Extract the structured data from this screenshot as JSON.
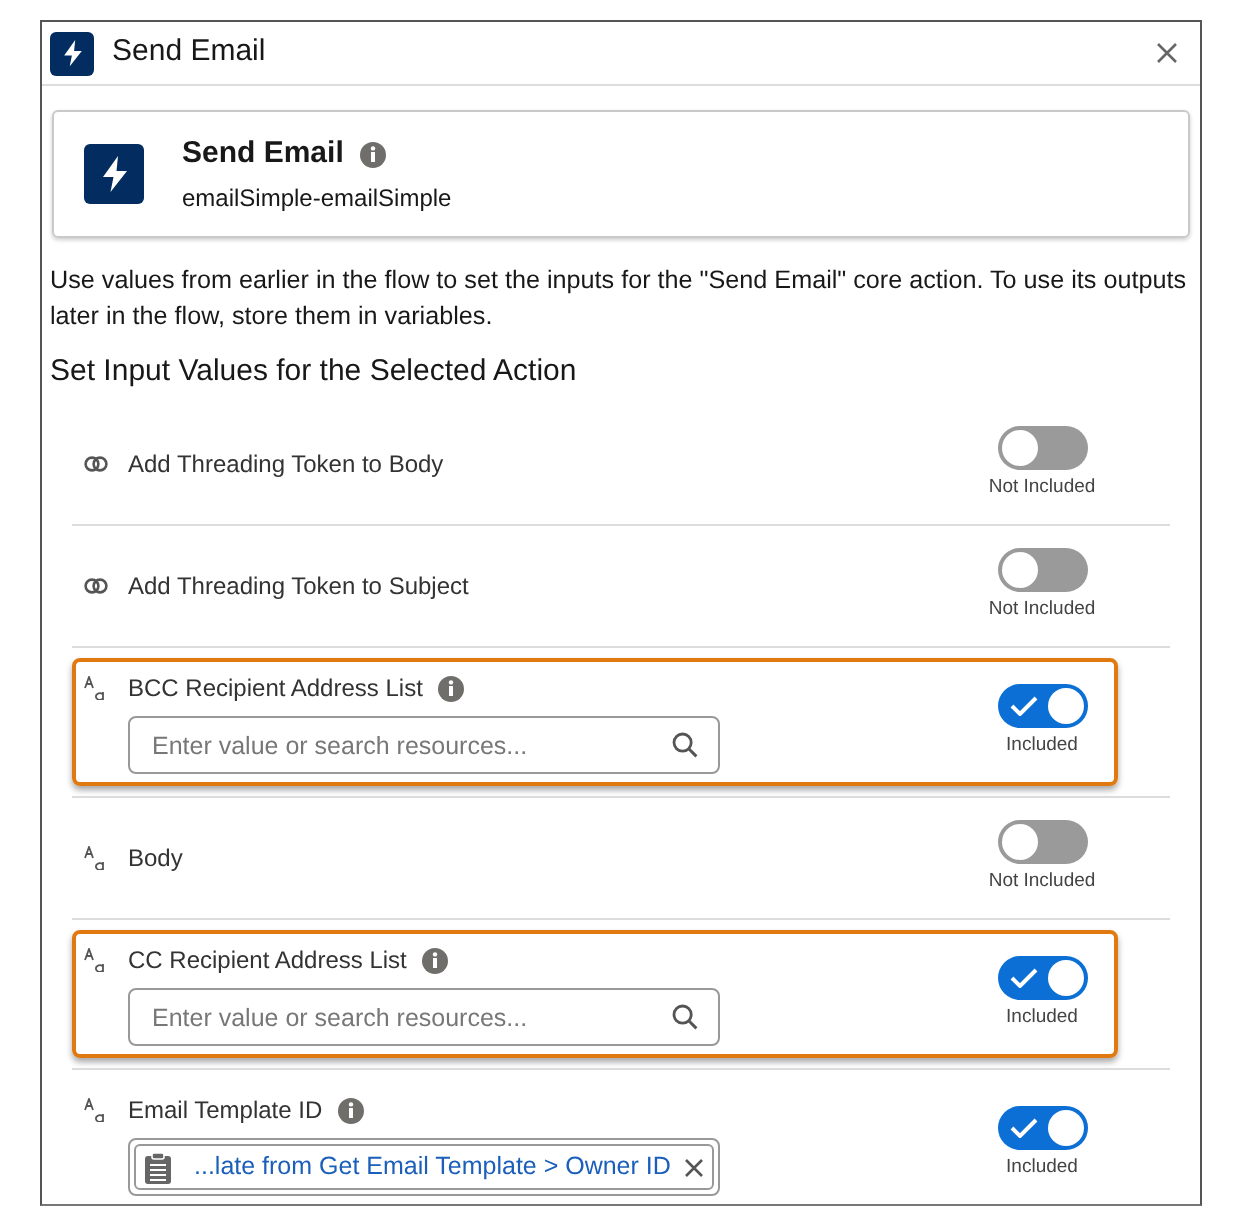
{
  "window": {
    "title": "Send Email"
  },
  "action_card": {
    "title": "Send Email",
    "name": "emailSimple-emailSimple",
    "info": true
  },
  "description": "Use values from earlier in the flow to set the inputs for the \"Send Email\" core action. To use its outputs later in the flow, store them in variables.",
  "section_heading": "Set Input Values for the Selected Action",
  "rows": [
    {
      "kind": "boolean",
      "label": "Add Threading Token to Body",
      "info": false,
      "highlighted": false,
      "included": false,
      "status": "Not Included"
    },
    {
      "kind": "boolean",
      "label": "Add Threading Token to Subject",
      "info": false,
      "highlighted": false,
      "included": false,
      "status": "Not Included"
    },
    {
      "kind": "text",
      "label": "BCC Recipient Address List",
      "info": true,
      "highlighted": true,
      "included": true,
      "status": "Included",
      "field": {
        "placeholder": "Enter value or search resources..."
      }
    },
    {
      "kind": "text",
      "label": "Body",
      "info": false,
      "highlighted": false,
      "included": false,
      "status": "Not Included"
    },
    {
      "kind": "text",
      "label": "CC Recipient Address List",
      "info": true,
      "highlighted": true,
      "included": true,
      "status": "Included",
      "field": {
        "placeholder": "Enter value or search resources..."
      }
    },
    {
      "kind": "text",
      "label": "Email Template ID",
      "info": true,
      "highlighted": false,
      "included": true,
      "status": "Included",
      "field": {
        "value": "...late from Get Email Template > Owner ID"
      }
    }
  ]
}
